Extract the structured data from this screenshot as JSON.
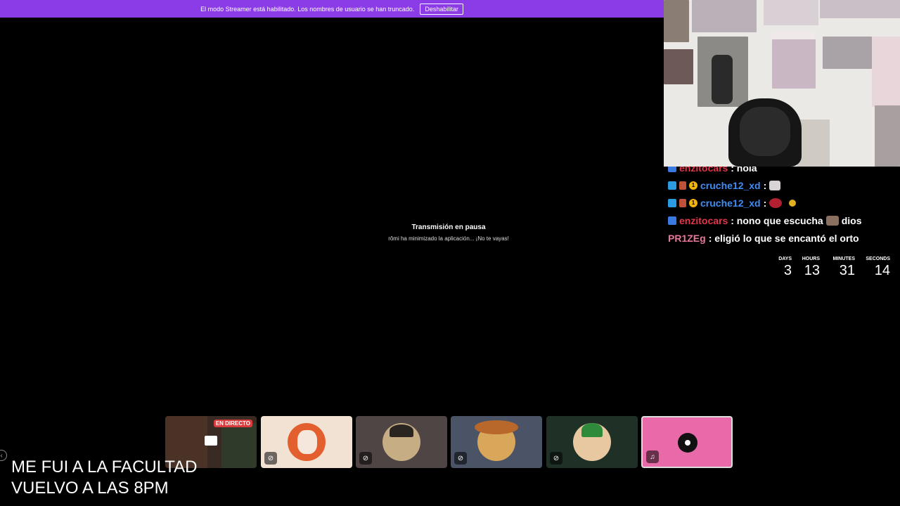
{
  "banner": {
    "message": "El modo Streamer está habilitado. Los nombres de usuario se han truncado.",
    "button_label": "Deshabilitar"
  },
  "paused": {
    "title": "Transmisión en pausa",
    "subtitle": "rômi ha minimizado la aplicación... ¡No te vayas!"
  },
  "chat": {
    "messages": [
      {
        "user": "enzitocars",
        "text": ": hola",
        "color": "#e8344a"
      },
      {
        "user": "cruche12_xd",
        "text": ":",
        "color": "#3f8df4"
      },
      {
        "user": "cruche12_xd",
        "text": ":",
        "color": "#3f8df4"
      },
      {
        "user": "enzitocars",
        "text": ": nono que escucha",
        "text2": "dios",
        "color": "#e8344a"
      },
      {
        "user": "PR1ZEg",
        "text": ": eligió lo que se encantó el orto",
        "color": "#e8789a"
      }
    ]
  },
  "countdown": {
    "days_label": "DAYS",
    "days": "3",
    "hours_label": "HOURS",
    "hours": "13",
    "minutes_label": "MINUTES",
    "minutes": "31",
    "seconds_label": "SECONDS",
    "seconds": "14"
  },
  "tiles": {
    "live_badge": "EN DIRECTO"
  },
  "overlay": {
    "line1": "ME FUI A LA FACULTAD",
    "line2": "VUELVO A LAS 8PM"
  },
  "icons": {
    "mute": "microphone-muted-icon",
    "screen": "screen-share-icon",
    "headset": "headset-icon",
    "record": "vinyl-record-icon"
  },
  "colors": {
    "banner": "#8b3ce6",
    "live": "#d83c3e",
    "pink_tile": "#e86aa8"
  }
}
